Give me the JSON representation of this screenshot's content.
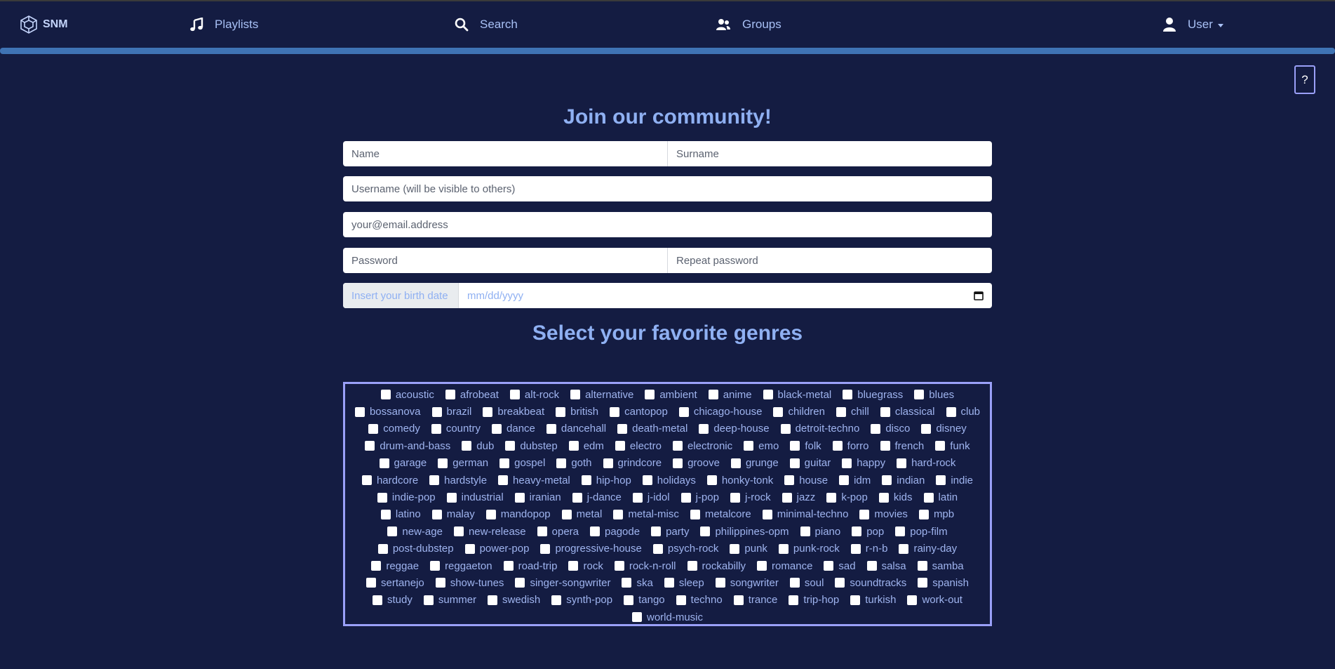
{
  "nav": {
    "brand": "SNM",
    "playlists": "Playlists",
    "search": "Search",
    "groups": "Groups",
    "user": "User"
  },
  "help_label": "?",
  "form": {
    "title": "Join our community!",
    "name_placeholder": "Name",
    "surname_placeholder": "Surname",
    "username_placeholder": "Username (will be visible to others)",
    "email_placeholder": "your@email.address",
    "password_placeholder": "Password",
    "repeat_password_placeholder": "Repeat password",
    "birth_label": "Insert your birth date",
    "birth_placeholder": "mm/dd/yyyy"
  },
  "genres_title": "Select your favorite genres",
  "genres": [
    "acoustic",
    "afrobeat",
    "alt-rock",
    "alternative",
    "ambient",
    "anime",
    "black-metal",
    "bluegrass",
    "blues",
    "bossanova",
    "brazil",
    "breakbeat",
    "british",
    "cantopop",
    "chicago-house",
    "children",
    "chill",
    "classical",
    "club",
    "comedy",
    "country",
    "dance",
    "dancehall",
    "death-metal",
    "deep-house",
    "detroit-techno",
    "disco",
    "disney",
    "drum-and-bass",
    "dub",
    "dubstep",
    "edm",
    "electro",
    "electronic",
    "emo",
    "folk",
    "forro",
    "french",
    "funk",
    "garage",
    "german",
    "gospel",
    "goth",
    "grindcore",
    "groove",
    "grunge",
    "guitar",
    "happy",
    "hard-rock",
    "hardcore",
    "hardstyle",
    "heavy-metal",
    "hip-hop",
    "holidays",
    "honky-tonk",
    "house",
    "idm",
    "indian",
    "indie",
    "indie-pop",
    "industrial",
    "iranian",
    "j-dance",
    "j-idol",
    "j-pop",
    "j-rock",
    "jazz",
    "k-pop",
    "kids",
    "latin",
    "latino",
    "malay",
    "mandopop",
    "metal",
    "metal-misc",
    "metalcore",
    "minimal-techno",
    "movies",
    "mpb",
    "new-age",
    "new-release",
    "opera",
    "pagode",
    "party",
    "philippines-opm",
    "piano",
    "pop",
    "pop-film",
    "post-dubstep",
    "power-pop",
    "progressive-house",
    "psych-rock",
    "punk",
    "punk-rock",
    "r-n-b",
    "rainy-day",
    "reggae",
    "reggaeton",
    "road-trip",
    "rock",
    "rock-n-roll",
    "rockabilly",
    "romance",
    "sad",
    "salsa",
    "samba",
    "sertanejo",
    "show-tunes",
    "singer-songwriter",
    "ska",
    "sleep",
    "songwriter",
    "soul",
    "soundtracks",
    "spanish",
    "study",
    "summer",
    "swedish",
    "synth-pop",
    "tango",
    "techno",
    "trance",
    "trip-hop",
    "turkish",
    "work-out",
    "world-music"
  ],
  "colors": {
    "background": "#141c42",
    "accent": "#8fb0f2",
    "progress": "#3f73b4",
    "box_border": "#9aa0f8"
  }
}
